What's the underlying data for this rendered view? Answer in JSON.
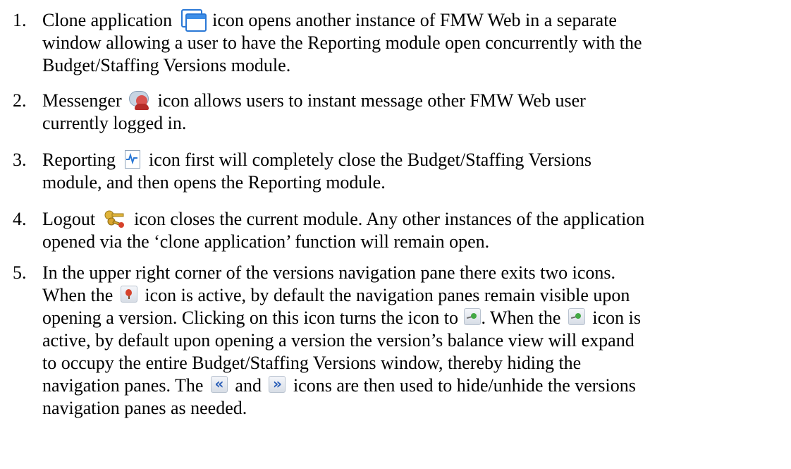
{
  "items": [
    {
      "number": "1.",
      "lines": [
        {
          "a": "Clone application",
          "b": "icon opens another instance of FMW Web in a separate"
        },
        {
          "a": "window allowing a user to have the Reporting module open concurrently with the"
        },
        {
          "a": "Budget/Staffing Versions module."
        }
      ],
      "icon": "clone-application-icon"
    },
    {
      "number": "2.",
      "lines": [
        {
          "a": "Messenger",
          "b": "icon allows users to instant message other FMW Web user"
        },
        {
          "a": "currently logged in."
        }
      ],
      "icon": "messenger-icon"
    },
    {
      "number": "3.",
      "lines": [
        {
          "a": "Reporting",
          "b": "icon first will completely close the Budget/Staffing Versions"
        },
        {
          "a": "module, and then opens the Reporting module."
        }
      ],
      "icon": "reporting-icon"
    },
    {
      "number": "4.",
      "lines": [
        {
          "a": "Logout",
          "b": "icon closes the current module.  Any other instances of the application"
        },
        {
          "a": "opened via the ‘clone application’ function will remain open."
        }
      ],
      "icon": "logout-keys-icon"
    },
    {
      "number": "5.",
      "lines": [
        {
          "a": "In the upper right corner of the versions navigation pane there exits two icons."
        },
        {
          "a": "When the",
          "b": "icon is active, by default the navigation panes remain visible upon"
        },
        {
          "a": "opening a version.  Clicking on this icon turns the icon to",
          "b": ".  When the",
          "c": "icon is"
        },
        {
          "a": "active, by default upon opening a version the version’s balance view will expand"
        },
        {
          "a": "to occupy the entire Budget/Staffing Versions window, thereby hiding the"
        },
        {
          "a": "navigation panes.  The",
          "b": "and",
          "c": "icons are then used to hide/unhide the versions"
        },
        {
          "a": "navigation panes as needed."
        }
      ]
    }
  ],
  "icons": {
    "clone": "clone-application-icon",
    "messenger": "messenger-icon",
    "reporting": "reporting-icon",
    "logout": "logout-keys-icon",
    "pin_red": "pin-red-icon",
    "pin_green": "pin-green-icon",
    "collapse": "double-chevron-left-icon",
    "expand": "double-chevron-right-icon"
  },
  "icon_glyphs": {
    "collapse": "«",
    "expand": "»"
  },
  "colors": {
    "clone_blue": "#2a78d6",
    "messenger_red": "#d9534f",
    "pin_red": "#d6422b",
    "pin_green": "#43a845",
    "chevron_blue": "#2b5fb8"
  }
}
